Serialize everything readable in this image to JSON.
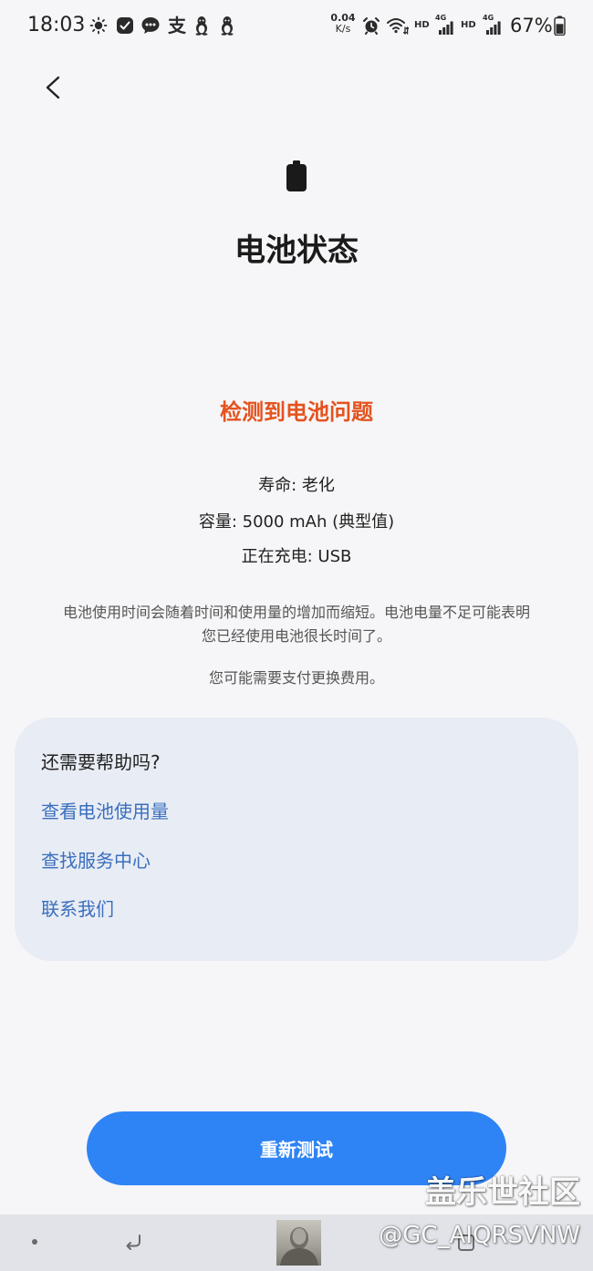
{
  "status_bar": {
    "time": "18:03",
    "left_icons": [
      "sun-icon",
      "app-check-icon",
      "message-icon",
      "alipay-icon",
      "qq-icon",
      "qq-icon"
    ],
    "alipay_glyph": "支",
    "net_speed_value": "0.04",
    "net_speed_unit": "K/s",
    "hd_label_1": "HD",
    "network_1": "4G",
    "hd_label_2": "HD",
    "network_2": "4G",
    "battery_percent": "67%",
    "battery_level": 0.67,
    "right_icons": [
      "alarm-icon",
      "wifi-icon",
      "signal-icon",
      "signal-icon",
      "battery-icon"
    ]
  },
  "header": {
    "back_icon": "chevron-left-icon"
  },
  "battery_status": {
    "icon": "battery-icon",
    "title": "电池状态",
    "warning": "检测到电池问题",
    "details": [
      "寿命: 老化",
      "容量: 5000 mAh (典型值)",
      "正在充电: USB"
    ],
    "description_lines": [
      "电池使用时间会随着时间和使用量的增加而缩短。电池电量不足可能表明",
      "您已经使用电池很长时间了。"
    ],
    "cost_note": "您可能需要支付更换费用。"
  },
  "help_card": {
    "heading": "还需要帮助吗?",
    "links": [
      "查看电池使用量",
      "查找服务中心",
      "联系我们"
    ]
  },
  "retest_button": {
    "label": "重新测试"
  },
  "navigation_bar": {
    "icons": [
      "dot-indicator",
      "back-arrow-icon",
      "app-thumbnail",
      "recent-apps-icon"
    ]
  },
  "watermark": {
    "brand": "盖乐世社区",
    "handle": "@GC_AIQRSVNW"
  },
  "colors": {
    "page_background": "#f6f6f8",
    "warning": "#e4531f",
    "link": "#3a6fbe",
    "card_background": "#e8ecf4",
    "accent": "#2f84f5",
    "nav_background": "#e1e3e9"
  }
}
